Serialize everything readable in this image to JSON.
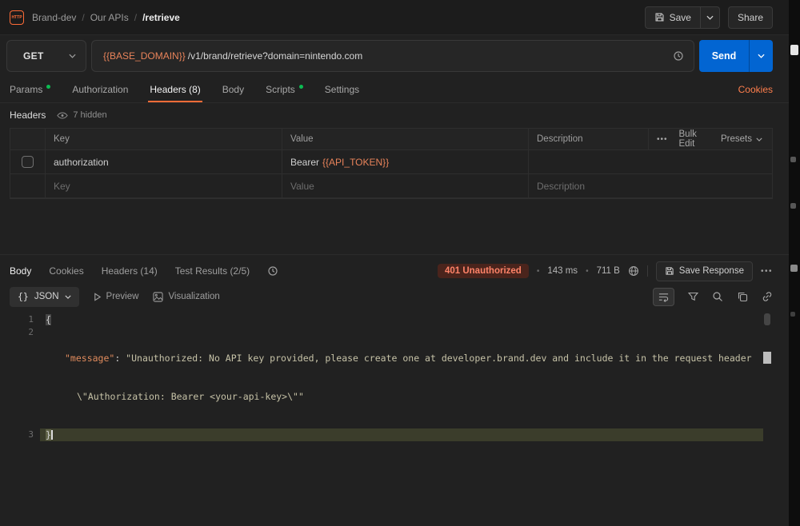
{
  "topbar": {
    "logo_text": "HTTP",
    "breadcrumbs": [
      "Brand-dev",
      "Our APIs",
      "/retrieve"
    ],
    "separator": "/",
    "save_label": "Save",
    "share_label": "Share"
  },
  "request": {
    "method": "GET",
    "url_variable": "{{BASE_DOMAIN}}",
    "url_path": "/v1/brand/retrieve?domain=nintendo.com",
    "send_label": "Send"
  },
  "request_tabs": [
    {
      "label": "Params"
    },
    {
      "label": "Authorization"
    },
    {
      "label": "Headers (8)"
    },
    {
      "label": "Body"
    },
    {
      "label": "Scripts"
    },
    {
      "label": "Settings"
    }
  ],
  "cookies_link": "Cookies",
  "headers_panel": {
    "title": "Headers",
    "hidden_label": "7 hidden",
    "columns": [
      "Key",
      "Value",
      "Description"
    ],
    "more_label": "•••",
    "bulk_edit_label": "Bulk Edit",
    "presets_label": "Presets",
    "row": {
      "key": "authorization",
      "value_prefix": "Bearer ",
      "value_variable": "{{API_TOKEN}}",
      "description": ""
    },
    "placeholder_row": {
      "key": "Key",
      "value": "Value",
      "description": "Description"
    }
  },
  "response": {
    "tabs": [
      "Body",
      "Cookies",
      "Headers (14)",
      "Test Results (2/5)"
    ],
    "status_badge": "401 Unauthorized",
    "separator_dot": "•",
    "time": "143 ms",
    "size": "711 B",
    "save_response_label": "Save Response",
    "more_label": "•••",
    "braces_icon": "{}",
    "format_label": "JSON",
    "preview_label": "Preview",
    "visualization_label": "Visualization",
    "code": {
      "line_numbers": [
        "1",
        "2",
        "3"
      ],
      "open_brace": "{",
      "key": "\"message\"",
      "colon": ": ",
      "value_part1": "\"Unauthorized: No API key provided, please create one at developer.brand.dev and include it in the request header",
      "value_part2": "\\\"Authorization: Bearer <your-api-key>\\\"\"",
      "close_brace": "}"
    }
  },
  "colors": {
    "accent_orange": "#ff6c37",
    "send_blue": "#0265d2",
    "success_green": "#0cbb52",
    "error_text": "#ff8368"
  }
}
